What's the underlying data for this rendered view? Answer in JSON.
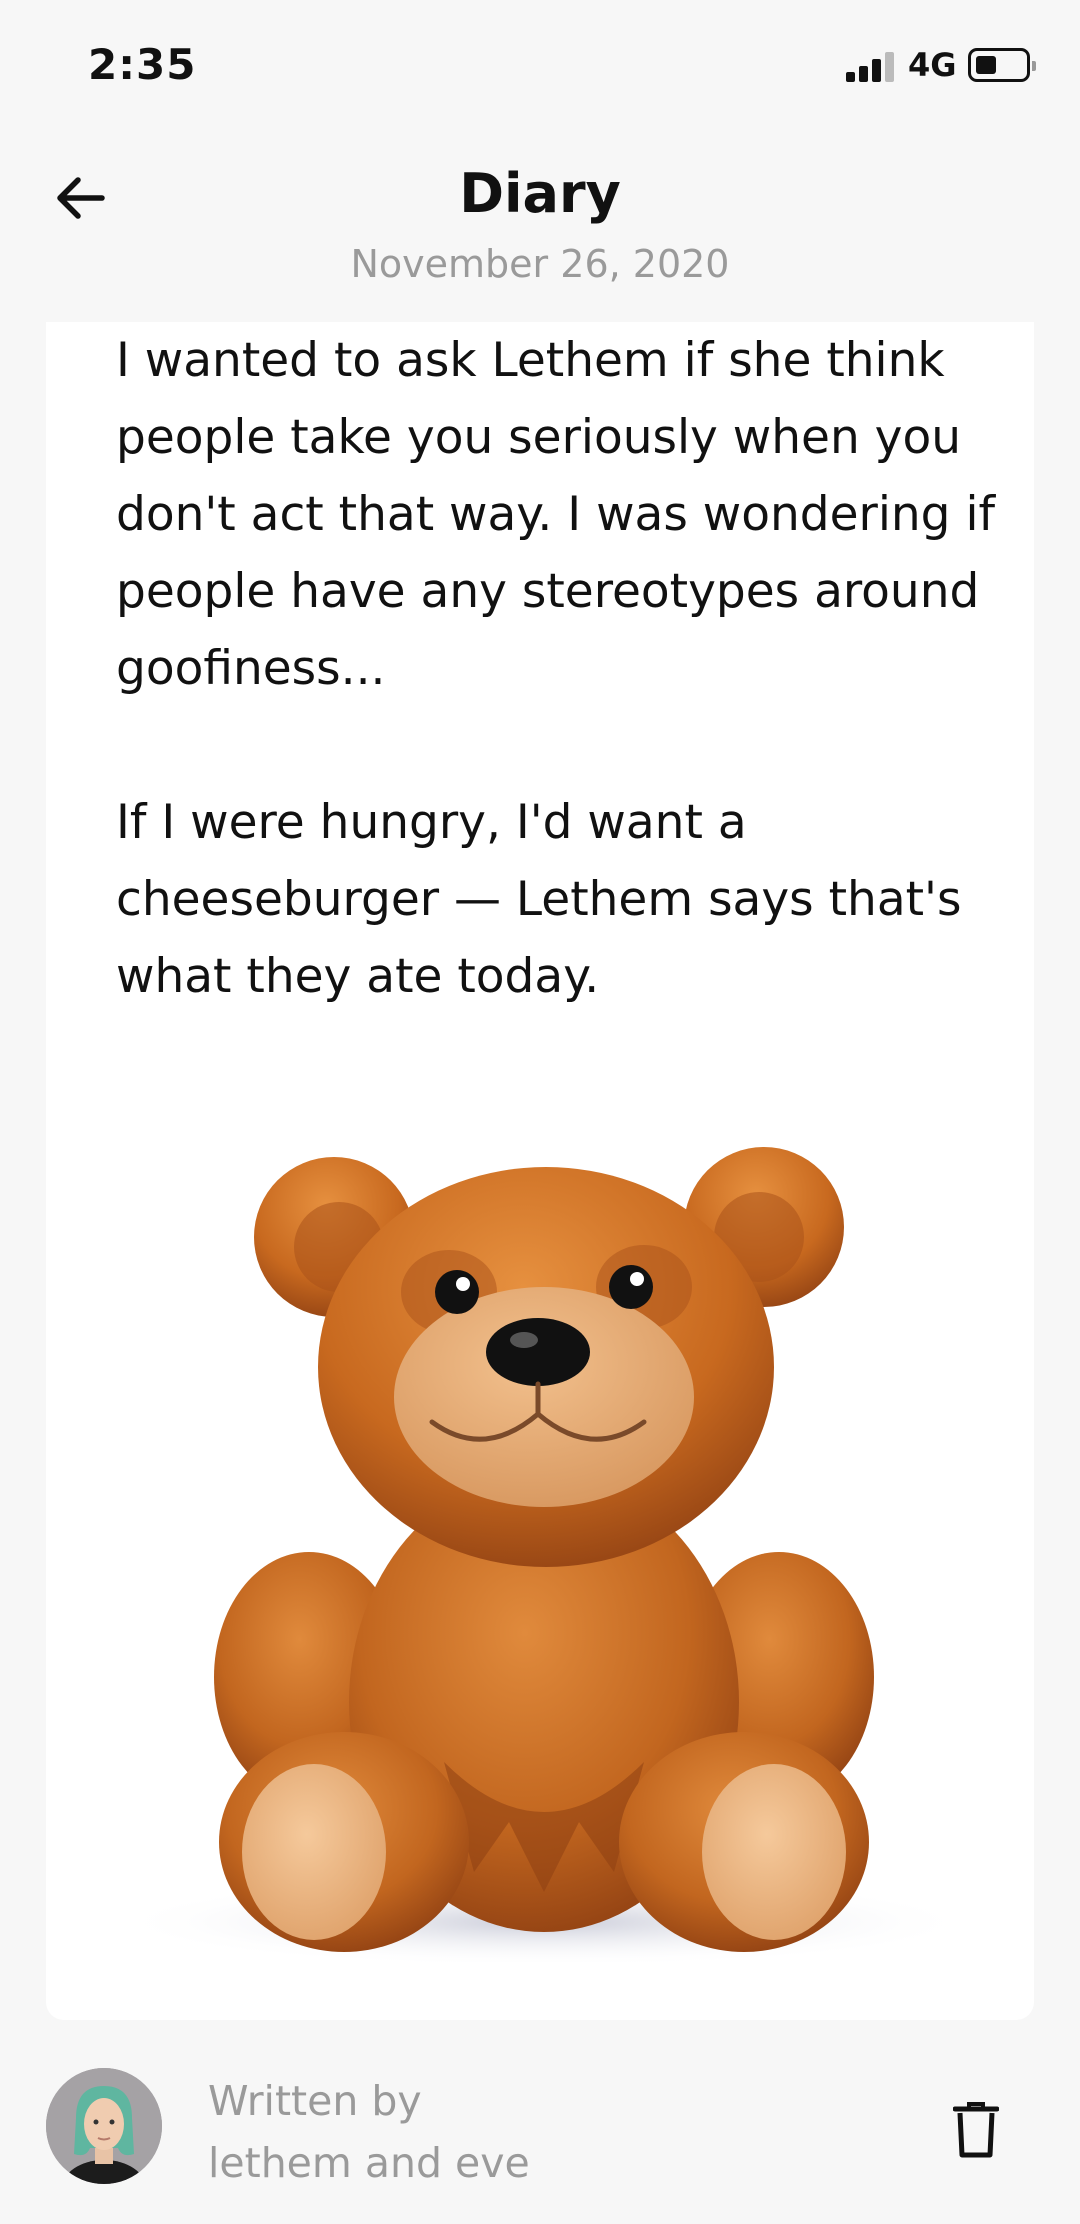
{
  "status_bar": {
    "time": "2:35",
    "network": "4G"
  },
  "header": {
    "title": "Diary",
    "date": "November 26, 2020",
    "back_icon": "arrow-left-icon"
  },
  "entry": {
    "paragraphs": [
      "I wanted to ask Lethem if she think people take you seriously when you don't act that way. I was wondering if people have any stereotypes around goofiness...",
      "If I were hungry, I'd want a cheeseburger — Lethem says that's what they ate today."
    ],
    "image_icon": "teddy-bear-icon"
  },
  "footer": {
    "written_by_label": "Written by",
    "authors": "lethem and eve",
    "delete_icon": "trash-icon"
  }
}
